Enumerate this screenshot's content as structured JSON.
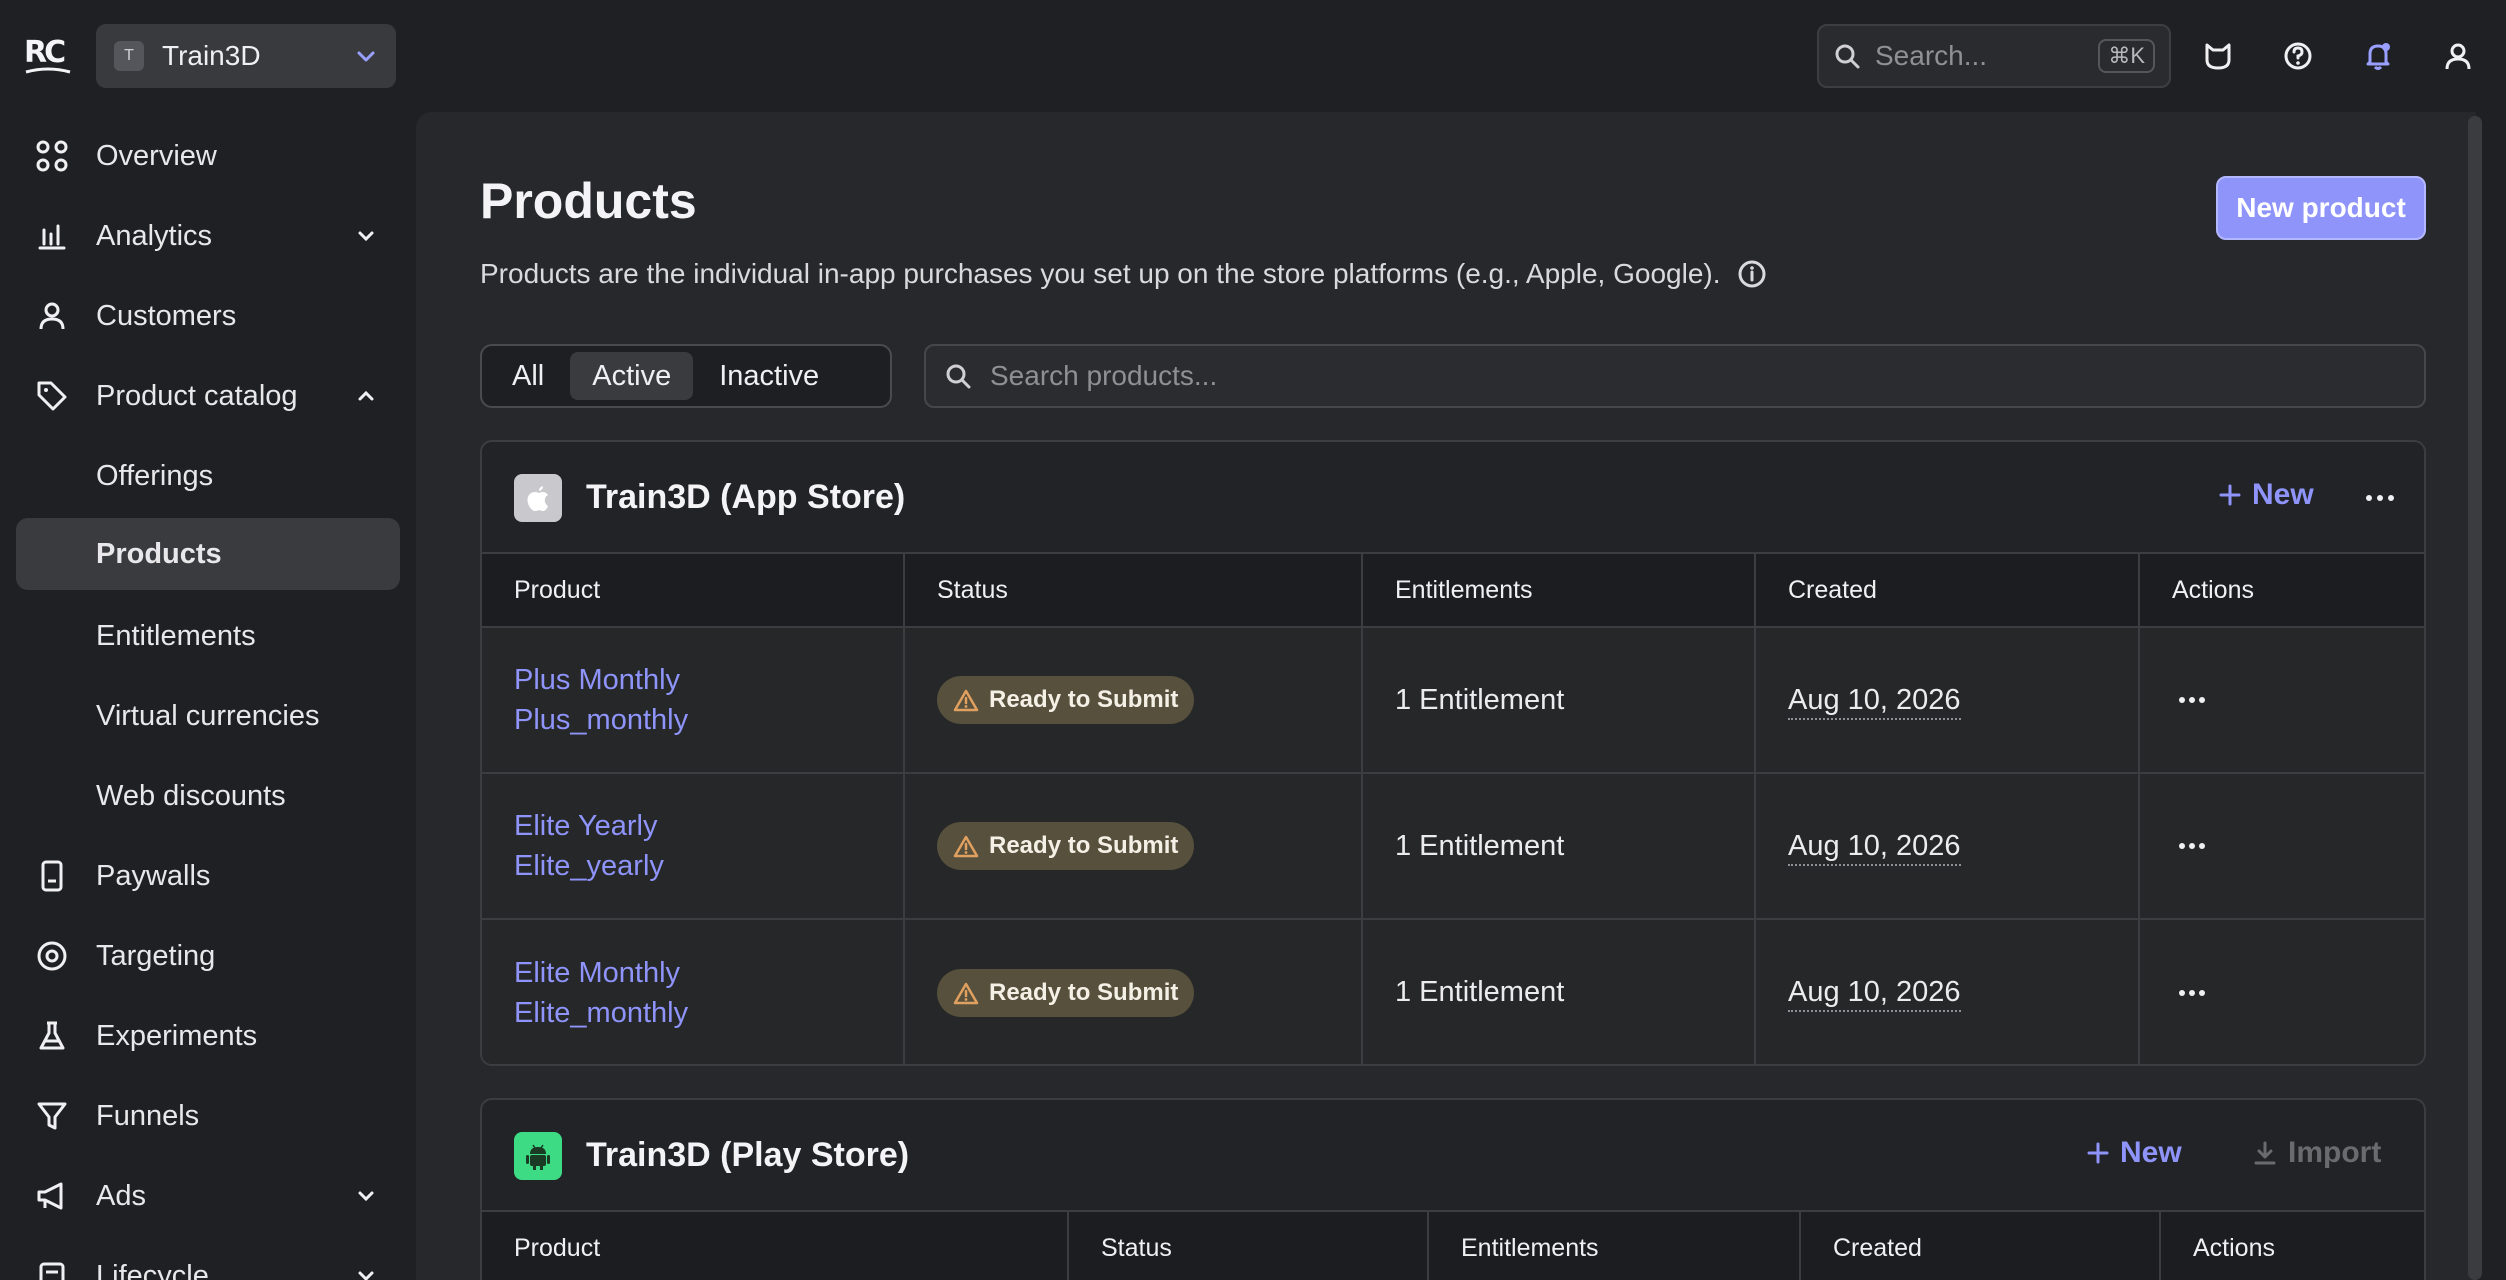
{
  "header": {
    "logo_text": "RC",
    "project": {
      "avatar_letter": "T",
      "name": "Train3D"
    },
    "search": {
      "placeholder": "Search...",
      "shortcut": "⌘K"
    },
    "icons": [
      "cat-icon",
      "help-icon",
      "bell-icon",
      "user-icon"
    ]
  },
  "sidebar": {
    "items": [
      {
        "label": "Overview",
        "icon": "grid-icon"
      },
      {
        "label": "Analytics",
        "icon": "chart-icon",
        "chevron": "down"
      },
      {
        "label": "Customers",
        "icon": "person-icon"
      },
      {
        "label": "Product catalog",
        "icon": "tag-icon",
        "chevron": "up"
      },
      {
        "label": "Offerings"
      },
      {
        "label": "Products",
        "active": true
      },
      {
        "label": "Entitlements"
      },
      {
        "label": "Virtual currencies"
      },
      {
        "label": "Web discounts"
      },
      {
        "label": "Paywalls",
        "icon": "phone-icon"
      },
      {
        "label": "Targeting",
        "icon": "target-icon"
      },
      {
        "label": "Experiments",
        "icon": "flask-icon"
      },
      {
        "label": "Funnels",
        "icon": "funnel-icon"
      },
      {
        "label": "Ads",
        "icon": "megaphone-icon",
        "chevron": "down"
      },
      {
        "label": "Lifecycle",
        "icon": "lifecycle-icon",
        "chevron": "down"
      }
    ]
  },
  "main": {
    "title": "Products",
    "new_product_label": "New product",
    "description": "Products are the individual in-app purchases you set up on the store platforms (e.g., Apple, Google).",
    "filters": {
      "all": "All",
      "active": "Active",
      "inactive": "Inactive",
      "selected": "Active"
    },
    "search_placeholder": "Search products...",
    "columns": [
      "Product",
      "Status",
      "Entitlements",
      "Created",
      "Actions"
    ],
    "app_store": {
      "title": "Train3D (App Store)",
      "new_label": "New",
      "rows": [
        {
          "name": "Plus Monthly",
          "id": "Plus_monthly",
          "status": "Ready to Submit",
          "entitlements": "1 Entitlement",
          "created": "Aug 10, 2026"
        },
        {
          "name": "Elite Yearly",
          "id": "Elite_yearly",
          "status": "Ready to Submit",
          "entitlements": "1 Entitlement",
          "created": "Aug 10, 2026"
        },
        {
          "name": "Elite Monthly",
          "id": "Elite_monthly",
          "status": "Ready to Submit",
          "entitlements": "1 Entitlement",
          "created": "Aug 10, 2026"
        }
      ]
    },
    "play_store": {
      "title": "Train3D (Play Store)",
      "new_label": "New",
      "import_label": "Import"
    }
  },
  "colors": {
    "accent": "#8e94f9",
    "background": "#1f2023",
    "panel": "#27282b",
    "badge_bg": "#57503c",
    "warning": "#e0a060",
    "android": "#3ddc84"
  }
}
